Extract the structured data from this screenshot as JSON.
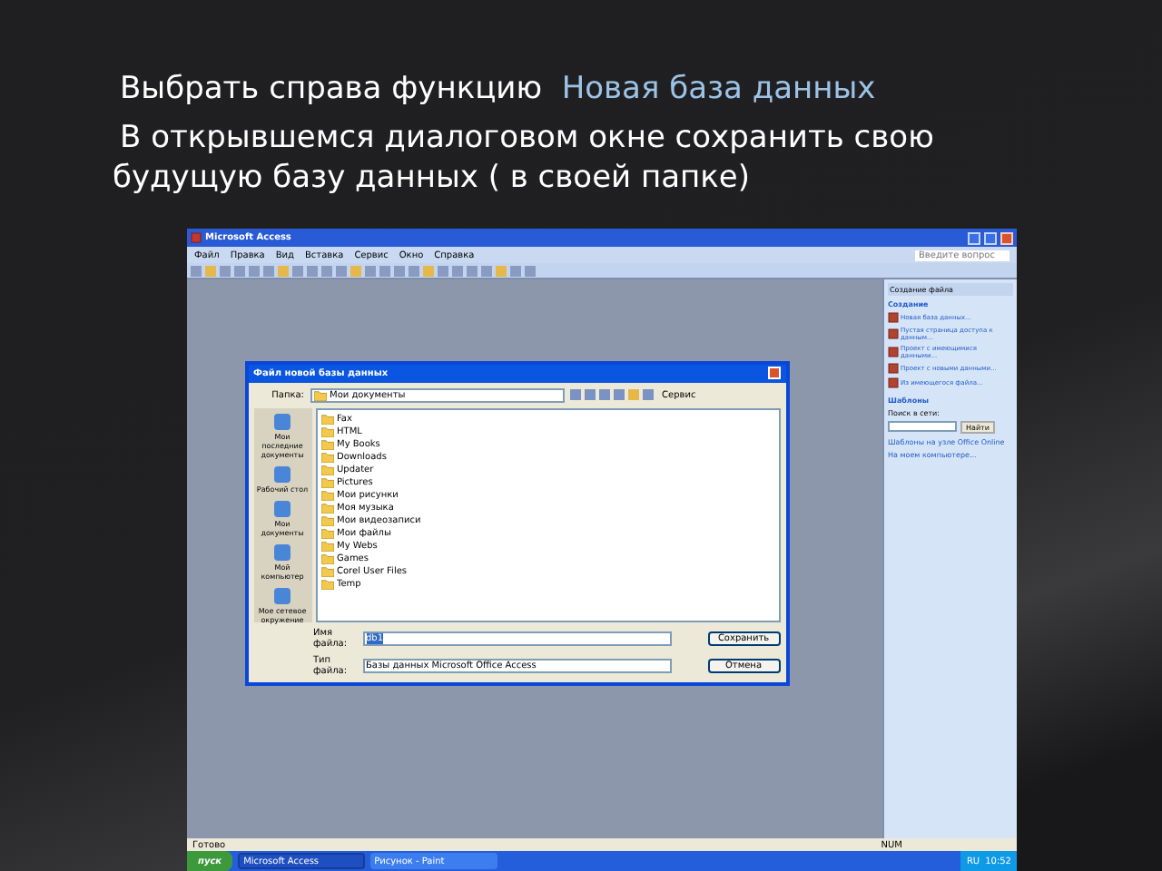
{
  "slide": {
    "line_1": {
      "text": "Выбрать справа функцию",
      "highlight": "Новая база данных"
    },
    "line_2": "В открывшемся диалоговом окне сохранить свою будущую базу данных ( в своей папке)"
  },
  "app": {
    "title": "Microsoft Access",
    "menu": [
      "Файл",
      "Правка",
      "Вид",
      "Вставка",
      "Сервис",
      "Окно",
      "Справка"
    ],
    "help_search": {
      "placeholder": "Введите вопрос"
    },
    "task_pane": {
      "title": "Создание файла",
      "section_create": "Создание",
      "create_links": [
        "Новая база данных...",
        "Пустая страница доступа к данным...",
        "Проект с имеющимися данными...",
        "Проект с новыми данными...",
        "Из имеющегося файла..."
      ],
      "section_templates": "Шаблоны",
      "search_label": "Поиск в сети:",
      "search_button": "Найти",
      "template_links": [
        "Шаблоны на узле Office Online",
        "На моем компьютере..."
      ]
    },
    "dialog": {
      "title": "Файл новой базы данных",
      "folder_label": "Папка:",
      "folder": "Мои документы",
      "tools": "Сервис",
      "places": [
        "Мои последние документы",
        "Рабочий стол",
        "Мои документы",
        "Мой компьютер",
        "Мое сетевое окружение"
      ],
      "files": [
        "Fax",
        "HTML",
        "My Books",
        "Downloads",
        "Updater",
        "Pictures",
        "Мои рисунки",
        "Моя музыка",
        "Мои видеозаписи",
        "Мои файлы",
        "My Webs",
        "Games",
        "Corel User Files",
        "Temp"
      ],
      "name_label": "Имя файла:",
      "name_value": "db1",
      "type_label": "Тип файла:",
      "type_value": "Базы данных Microsoft Office Access",
      "buttons": [
        "Сохранить",
        "Отмена"
      ]
    },
    "status": "Готово",
    "status_right": "NUM",
    "taskbar": {
      "start": "пуск",
      "tasks": [
        {
          "label": "Microsoft Access",
          "selected": true
        },
        {
          "label": "Рисунок - Paint",
          "selected": false
        }
      ],
      "lang": "RU",
      "clock": "10:52"
    }
  }
}
